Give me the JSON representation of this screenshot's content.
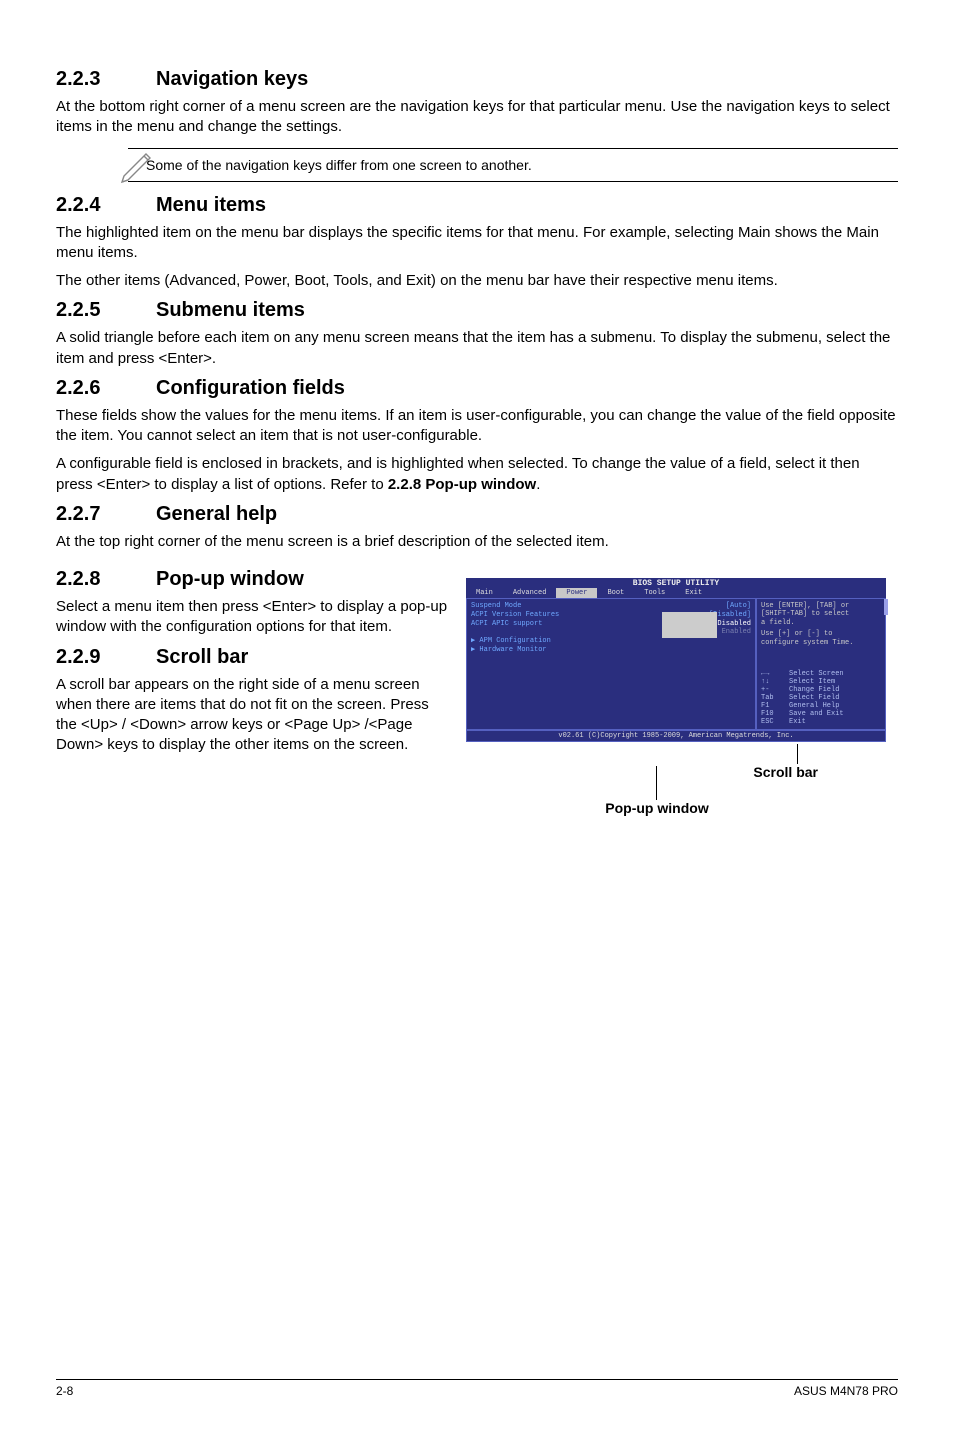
{
  "sec": {
    "s3": {
      "num": "2.2.3",
      "title": "Navigation keys",
      "p1": "At the bottom right corner of a menu screen are the navigation keys for that particular menu. Use the navigation keys to select items in the menu and change the settings.",
      "note": "Some of the navigation keys differ from one screen to another."
    },
    "s4": {
      "num": "2.2.4",
      "title": "Menu items",
      "p1": "The highlighted item on the menu bar  displays the specific items for that menu. For example, selecting Main shows the Main menu items.",
      "p2": "The other items (Advanced, Power, Boot, Tools, and Exit) on the menu bar have their respective menu items."
    },
    "s5": {
      "num": "2.2.5",
      "title": "Submenu items",
      "p1": "A solid triangle before each item on any menu screen means that the item has a submenu. To display the submenu, select the item and press <Enter>."
    },
    "s6": {
      "num": "2.2.6",
      "title": "Configuration fields",
      "p1": "These fields show the values for the menu items. If an item is user-configurable, you can change the value of the field opposite the item. You cannot select an item that is not user-configurable.",
      "p2a": "A configurable field is enclosed in brackets, and is highlighted when selected. To change the value of a field, select it then press <Enter> to display a list of options. Refer to ",
      "p2b": "2.2.8 Pop-up window",
      "p2c": "."
    },
    "s7": {
      "num": "2.2.7",
      "title": "General help",
      "p1": "At the top right corner of the menu screen is a brief description of the selected item."
    },
    "s8": {
      "num": "2.2.8",
      "title": "Pop-up window",
      "p1": "Select a menu item then press <Enter> to display a pop-up window with the configuration options for that item."
    },
    "s9": {
      "num": "2.2.9",
      "title": "Scroll bar",
      "p1": "A scroll bar appears on the right side of a menu screen when there are items that do not fit on the screen. Press the <Up> / <Down> arrow keys or <Page Up> /<Page Down> keys to display the other items on the screen."
    }
  },
  "bios": {
    "titlebar": "BIOS SETUP UTILITY",
    "tabs": {
      "main": "Main",
      "advanced": "Advanced",
      "power": "Power",
      "boot": "Boot",
      "tools": "Tools",
      "exit": "Exit"
    },
    "rows": {
      "suspend": {
        "label": "Suspend Mode",
        "value": "[Auto]"
      },
      "acpiver": {
        "label": "ACPI Version Features",
        "value": "[Disabled]"
      },
      "acpiapic": {
        "label": "ACPI APIC support",
        "value": "Disabled"
      },
      "acpiapic2": {
        "label": "",
        "value": "Enabled"
      },
      "apm": "▶ APM Configuration",
      "hw": "▶ Hardware Monitor"
    },
    "help": {
      "l1": "Use [ENTER], [TAB] or",
      "l2": "[SHIFT-TAB] to select",
      "l3": "a field.",
      "l4": "Use [+] or [-] to",
      "l5": "configure system Time."
    },
    "keys": {
      "k1": {
        "k": "←→",
        "d": "Select Screen"
      },
      "k2": {
        "k": "↑↓",
        "d": "Select Item"
      },
      "k3": {
        "k": "+-",
        "d": "Change Field"
      },
      "k4": {
        "k": "Tab",
        "d": "Select Field"
      },
      "k5": {
        "k": "F1",
        "d": "General Help"
      },
      "k6": {
        "k": "F10",
        "d": "Save and Exit"
      },
      "k7": {
        "k": "ESC",
        "d": "Exit"
      }
    },
    "footer": "v02.61 (C)Copyright 1985-2009, American Megatrends, Inc."
  },
  "callouts": {
    "scroll": "Scroll bar",
    "popup": "Pop-up window"
  },
  "footer": {
    "left": "2-8",
    "right": "ASUS M4N78 PRO"
  }
}
